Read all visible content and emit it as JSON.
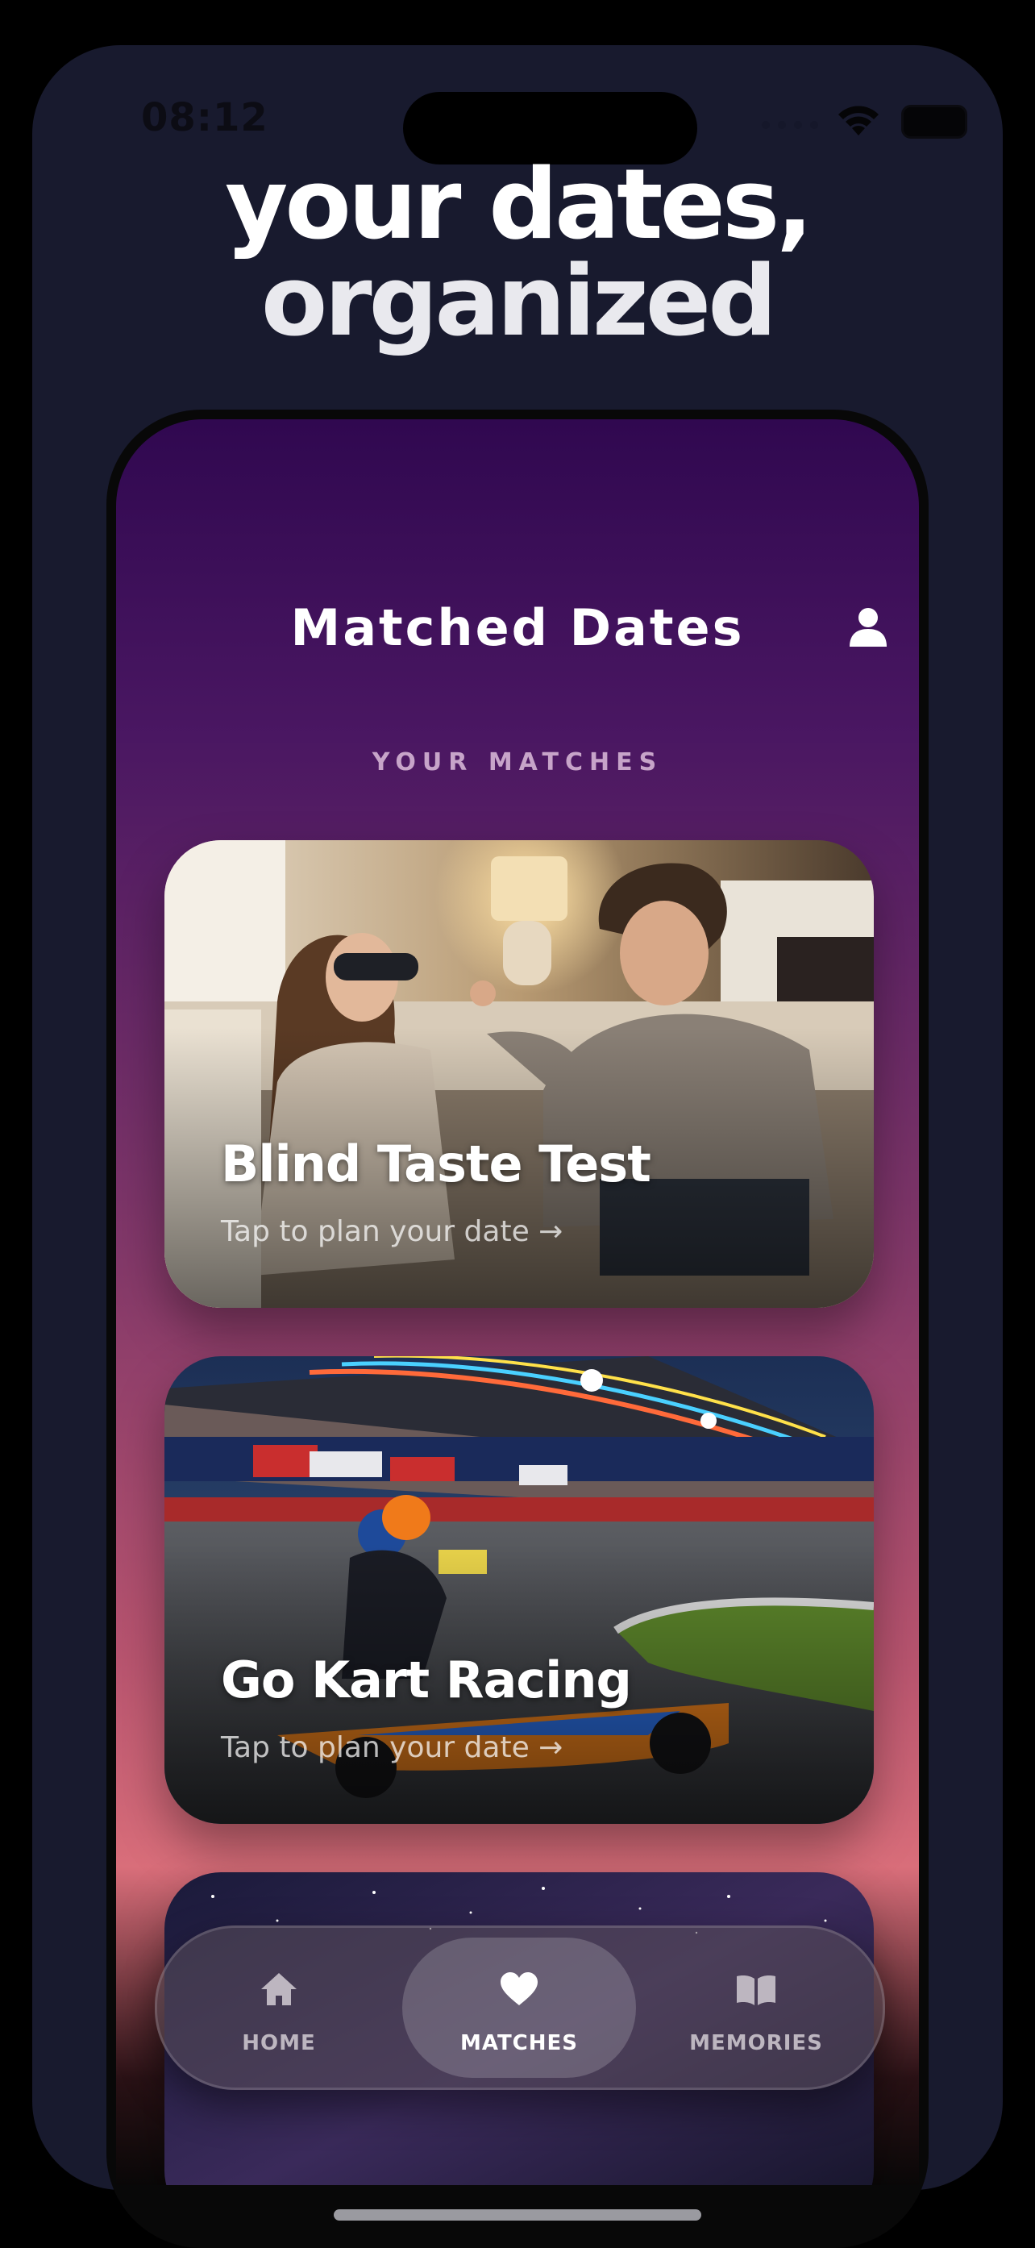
{
  "status_bar": {
    "time": "08:12"
  },
  "promo": {
    "line1": "your dates,",
    "line2": "organized"
  },
  "app": {
    "title": "Matched Dates",
    "section_label": "YOUR MATCHES",
    "cards": [
      {
        "title": "Blind Taste Test",
        "subtitle": "Tap to plan your date →",
        "image": "couple-blindfold-taste-photo"
      },
      {
        "title": "Go Kart Racing",
        "subtitle": "Tap to plan your date →",
        "image": "go-kart-race-photo"
      },
      {
        "title": "",
        "subtitle": "",
        "image": "starry-night-sky-photo"
      }
    ]
  },
  "tab_bar": {
    "tabs": [
      {
        "label": "HOME",
        "icon": "home-icon"
      },
      {
        "label": "MATCHES",
        "icon": "heart-icon",
        "selected": true
      },
      {
        "label": "MEMORIES",
        "icon": "book-icon"
      }
    ]
  },
  "colors": {
    "background_top": "#300850",
    "background_mid": "#7b3468",
    "background_bottom": "#d96e7a",
    "device_body": "#181a2e"
  }
}
